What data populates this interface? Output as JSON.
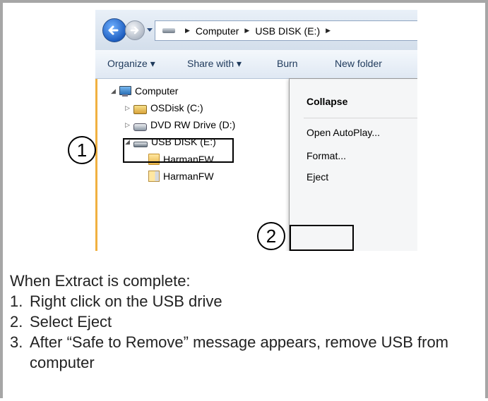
{
  "explorer": {
    "breadcrumb": [
      "Computer",
      "USB DISK (E:)"
    ],
    "toolbar": [
      "Organize ▾",
      "Share with ▾",
      "Burn",
      "New folder"
    ],
    "tree": [
      {
        "label": "Computer",
        "icon": "computer-icon",
        "expanded": true
      },
      {
        "label": "OSDisk (C:)",
        "icon": "hard-disk-icon"
      },
      {
        "label": "DVD RW Drive (D:)",
        "icon": "dvd-drive-icon"
      },
      {
        "label": "USB DISK (E:)",
        "icon": "usb-drive-icon",
        "expanded": true
      },
      {
        "label": "HarmanFW",
        "icon": "folder-icon"
      },
      {
        "label": "HarmanFW",
        "icon": "zip-folder-icon"
      }
    ],
    "context_menu": [
      "Collapse",
      "Open AutoPlay...",
      "Format...",
      "Eject"
    ]
  },
  "callouts": [
    "1",
    "2"
  ],
  "instructions": {
    "heading": "When Extract is complete:",
    "steps": [
      {
        "num": "1.",
        "text": "Right click on the USB drive"
      },
      {
        "num": "2.",
        "text": "Select Eject"
      },
      {
        "num": "3.",
        "text": "After “Safe to Remove” message appears, remove USB from computer"
      }
    ]
  },
  "colors": {
    "highlight_border": "#000000",
    "frame_border": "#a6a6a6"
  }
}
